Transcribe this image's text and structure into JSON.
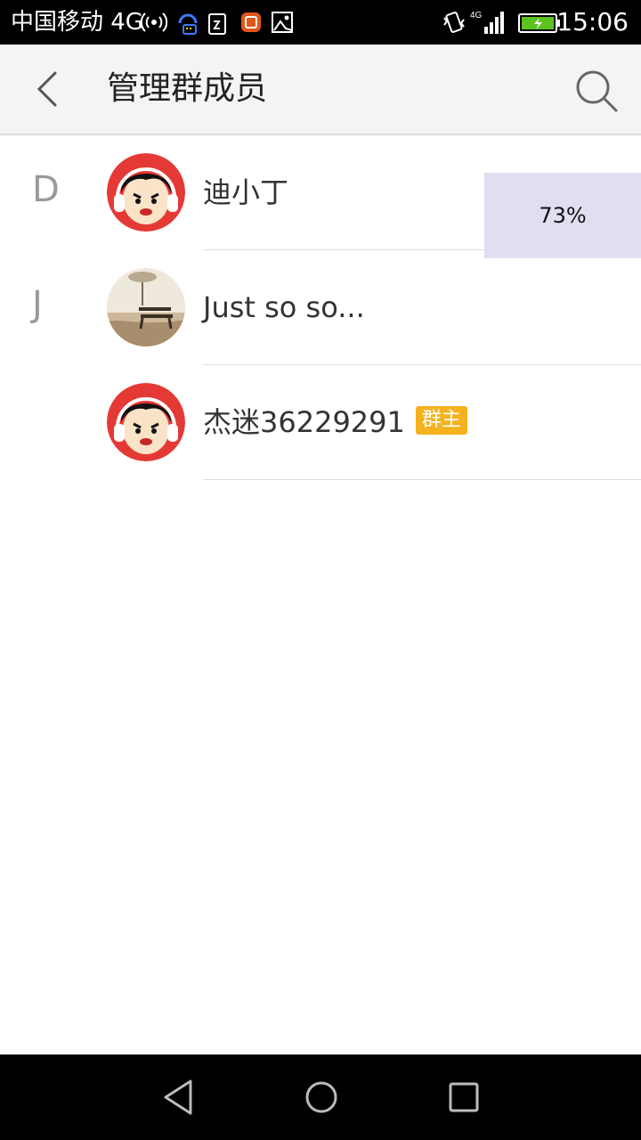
{
  "status_bar": {
    "carrier": "中国移动 4G",
    "time": "15:06",
    "icons": [
      "hotspot-icon",
      "headset-chat-icon",
      "sim-icon",
      "app-notification-icon",
      "image-icon",
      "vibrate-icon",
      "signal-4g-icon",
      "battery-charging-icon"
    ]
  },
  "header": {
    "title": "管理群成员",
    "back_icon": "chevron-left-icon",
    "search_icon": "search-icon"
  },
  "members": [
    {
      "section": "D",
      "name": "迪小丁",
      "badge": "",
      "avatar": "cartoon-boy-avatar"
    },
    {
      "section": "J",
      "name": "Just so so...",
      "badge": "",
      "avatar": "park-bench-avatar"
    },
    {
      "section": "",
      "name": "杰迷36229291",
      "badge": "群主",
      "avatar": "cartoon-boy-avatar"
    }
  ],
  "progress": {
    "value_percent": 73,
    "label": "73%"
  },
  "colors": {
    "status_bar_bg": "#000000",
    "header_bg": "#f4f4f4",
    "owner_badge": "#f5b21f",
    "progress_bg": "#e0dff2"
  },
  "nav_bar": {
    "icons": [
      "back-triangle-icon",
      "home-circle-icon",
      "recents-square-icon"
    ]
  }
}
